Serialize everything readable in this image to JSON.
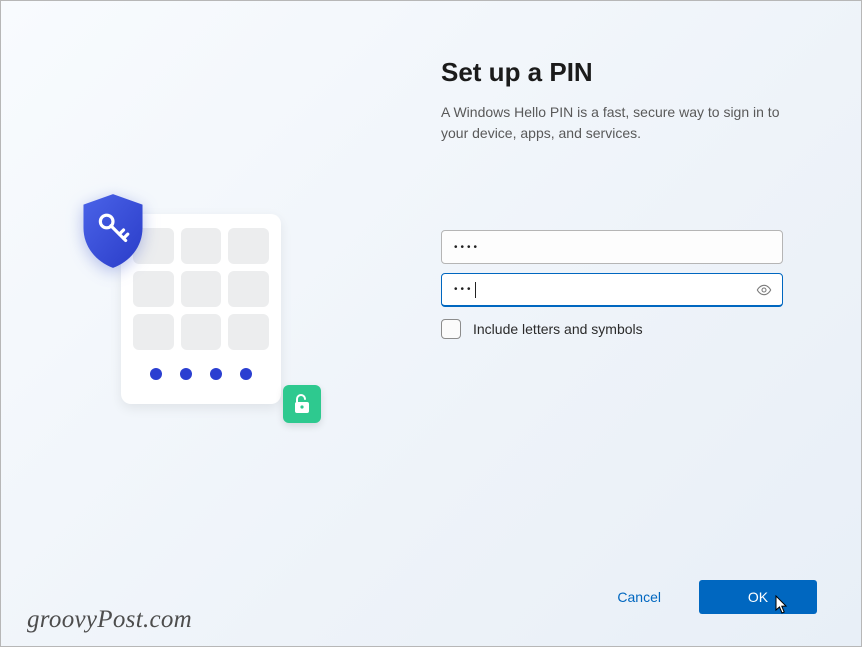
{
  "title": "Set up a PIN",
  "subtitle": "A Windows Hello PIN is a fast, secure way to sign in to your device, apps, and services.",
  "pin_field_value": "••••",
  "confirm_field_value": "•••",
  "checkbox": {
    "label": "Include letters and symbols",
    "checked": false
  },
  "buttons": {
    "cancel": "Cancel",
    "ok": "OK"
  },
  "watermark": "groovyPost.com",
  "icons": {
    "shield": "shield-key-icon",
    "unlock": "unlock-icon",
    "reveal": "eye-reveal-icon"
  },
  "colors": {
    "primary": "#0067c0",
    "accent_green": "#2ec98f",
    "shield_blue": "#3550d8"
  }
}
